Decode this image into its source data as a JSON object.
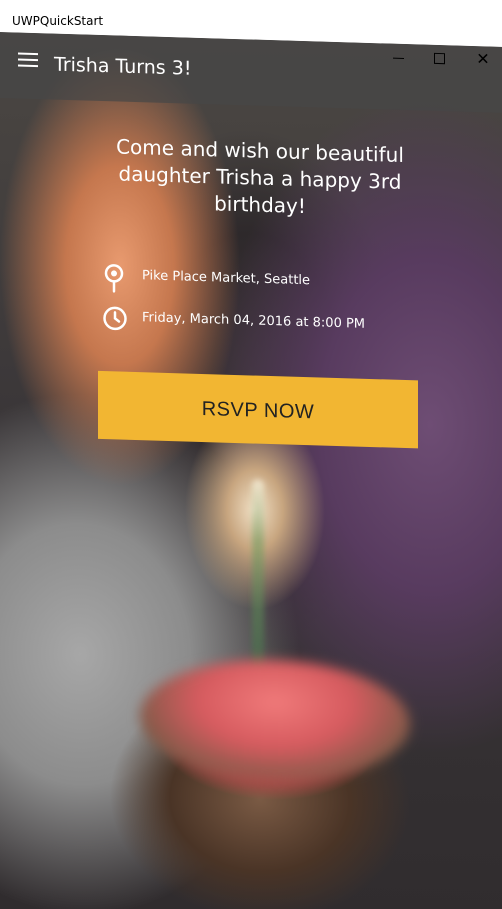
{
  "window": {
    "app_title": "UWPQuickStart",
    "close_glyph": "✕"
  },
  "header": {
    "title": "Trisha Turns 3!"
  },
  "event": {
    "message": "Come and wish our beautiful daughter Trisha a happy 3rd birthday!",
    "location": "Pike Place Market, Seattle",
    "datetime": "Friday, March 04, 2016 at 8:00 PM",
    "rsvp_label": "RSVP NOW"
  },
  "icons": {
    "menu": "hamburger-menu-icon",
    "location": "map-pin-icon",
    "time": "clock-icon"
  },
  "colors": {
    "accent": "#f2b632",
    "header_overlay": "#464646",
    "text": "#ffffff"
  }
}
